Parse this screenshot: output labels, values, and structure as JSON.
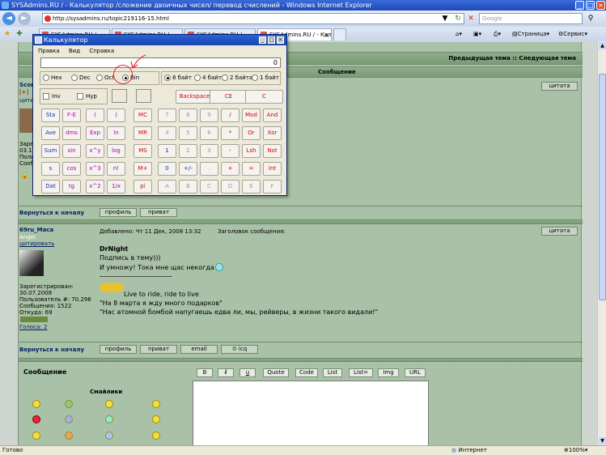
{
  "browser": {
    "title": "SYSAdmins.RU / - Калькулятор /сложение двоичных чисел/ перевод счислений - Windows Internet Explorer",
    "address": "http://sysadmins.ru/topic219116-15.html",
    "search_placeholder": "Google",
    "tabs": [
      "SYSAdmins.RU /...",
      "SYSAdmins.RU /...",
      "SYSAdmins.RU /...",
      "SYSAdmins.RU / - Кальк..."
    ],
    "commands": {
      "page": "Страница",
      "service": "Сервис"
    },
    "status_left": "Готово",
    "status_zone": "Интернет",
    "zoom": "100%"
  },
  "forum": {
    "topic_nav": "Предыдущая тема :: Следующая тема",
    "post_header": "Сообщение",
    "quote_btn": "цитата",
    "first_user": {
      "name": "Scor",
      "lines": [
        "[+]",
        "цитир",
        "Зарег",
        "03.11",
        "Поль",
        "Сооб"
      ]
    },
    "back_to_top": "Вернуться к началу",
    "btn_profile": "профиль",
    "btn_pm": "приват",
    "btn_email": "email",
    "btn_icq": "icq",
    "second_post": {
      "user": "69ru_Маса",
      "rank": "Angel",
      "quote_link": "цитировать",
      "added": "Добавлено: Чт 11 Дек, 2008 13:32",
      "subject": "Заголовок сообщения:",
      "author_quote": "DrNight",
      "line1": "Подпись в тему)))",
      "line2": "И умножу! Тока мне щас некогда",
      "sig1": "Live to ride, ride to live",
      "sig2": "\"На 8 марта я жду много подарков\"",
      "sig3": "\"Нас атомной бомбой напугаешь едва ли, мы, рейверы, в жизни такого видали!\"",
      "info": [
        "Зарегистрирован:",
        "30.07.2008",
        "Пользователь #: 70.296",
        "Сообщения: 1522",
        "Откуда: 69"
      ],
      "votes": "Голоса: 2"
    },
    "reply": {
      "label": "Сообщение",
      "smilies": "Смайлики",
      "tools": [
        "B",
        "i",
        "u",
        "Quote",
        "Code",
        "List",
        "List=",
        "Img",
        "URL"
      ]
    }
  },
  "calculator": {
    "title": "Калькулятор",
    "menu": [
      "Правка",
      "Вид",
      "Справка"
    ],
    "display": "0",
    "bases": [
      "Hex",
      "Dec",
      "Oct",
      "Bin"
    ],
    "base_selected": "Bin",
    "words": [
      "8 байт",
      "4 байта",
      "2 байта",
      "1 байт"
    ],
    "word_selected": "8 байт",
    "inv": "Inv",
    "hyp": "Hyp",
    "backspace": "Backspace",
    "ce": "CE",
    "clear": "C",
    "keys": [
      [
        "Sta",
        "F-E",
        "(",
        ")",
        "MC",
        "7",
        "8",
        "9",
        "/",
        "Mod",
        "And"
      ],
      [
        "Ave",
        "dms",
        "Exp",
        "ln",
        "MR",
        "4",
        "5",
        "6",
        "*",
        "Or",
        "Xor"
      ],
      [
        "Sum",
        "sin",
        "x^y",
        "log",
        "MS",
        "1",
        "2",
        "3",
        "-",
        "Lsh",
        "Not"
      ],
      [
        "s",
        "cos",
        "x^3",
        "n!",
        "M+",
        "0",
        "+/-",
        ".",
        "+",
        "=",
        "Int"
      ],
      [
        "Dat",
        "tg",
        "x^2",
        "1/x",
        "pi",
        "A",
        "B",
        "C",
        "D",
        "E",
        "F"
      ]
    ]
  }
}
